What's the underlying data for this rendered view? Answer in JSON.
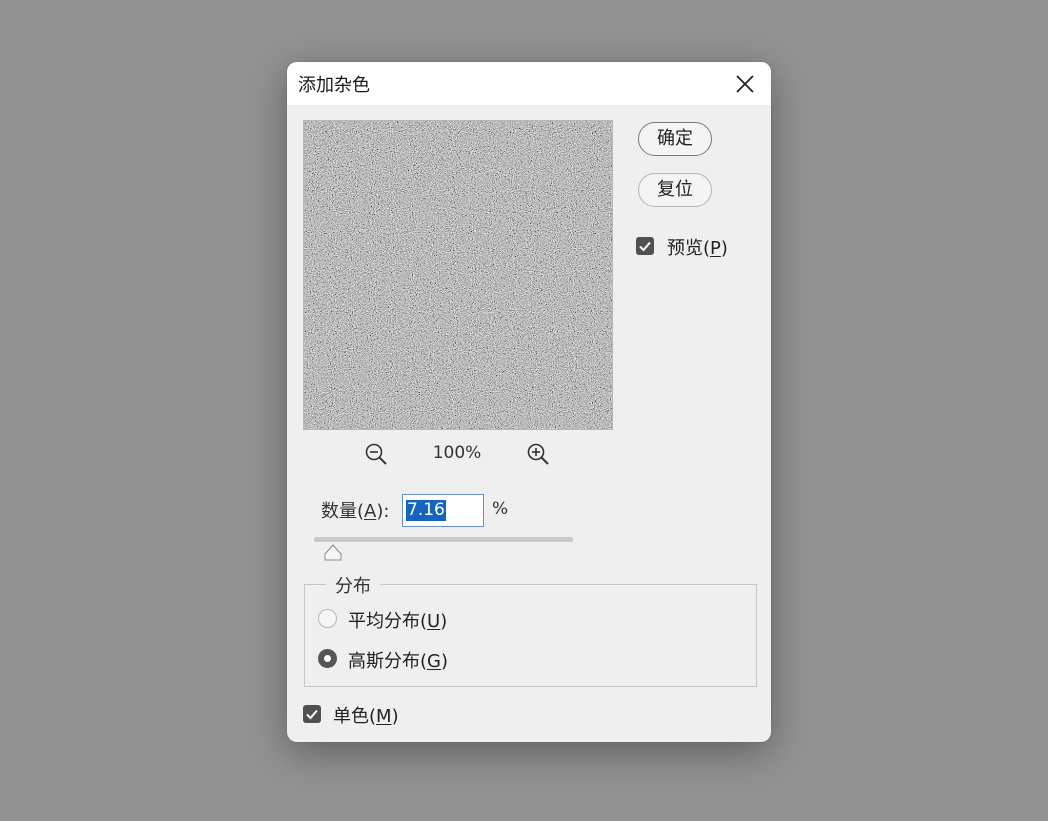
{
  "dialog": {
    "title": "添加杂色",
    "close_icon": "close-icon"
  },
  "preview_panel": {
    "zoom_out_icon": "zoom-out-icon",
    "zoom_in_icon": "zoom-in-icon",
    "zoom_level": "100%"
  },
  "actions": {
    "ok_label": "确定",
    "reset_label": "复位"
  },
  "preview_option": {
    "label": "预览(",
    "accesskey": "P",
    "label_end": ")",
    "checked": true
  },
  "amount": {
    "label": "数量(",
    "accesskey": "A",
    "label_end": "):",
    "value": "7.16",
    "unit": "%",
    "slider_level_percent": 7.16,
    "selection_color": "#1565c0"
  },
  "distribution": {
    "legend": "分布",
    "options": [
      {
        "label": "平均分布(",
        "accesskey": "U",
        "label_end": ")",
        "selected": false
      },
      {
        "label": "高斯分布(",
        "accesskey": "G",
        "label_end": ")",
        "selected": true
      }
    ]
  },
  "monochrome": {
    "label": "单色(",
    "accesskey": "M",
    "label_end": ")",
    "checked": true
  },
  "colors": {
    "backdrop": "#929292",
    "dialog_bg": "#efefef",
    "checkbox_fill": "#505050"
  }
}
